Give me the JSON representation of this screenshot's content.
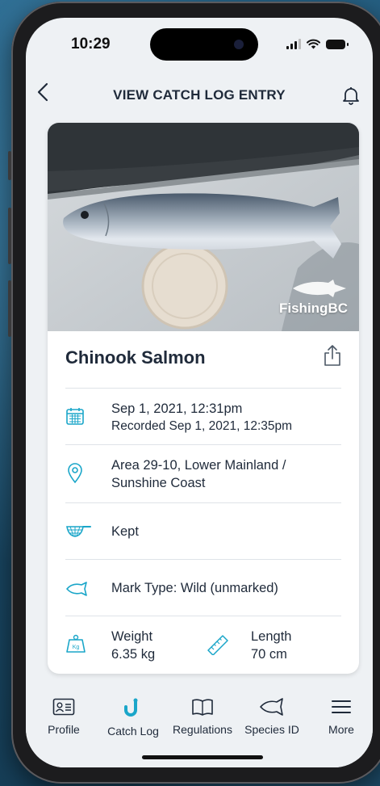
{
  "status": {
    "time": "10:29"
  },
  "header": {
    "title": "VIEW CATCH LOG ENTRY"
  },
  "photo": {
    "brand_text": "FishingBC"
  },
  "entry": {
    "species": "Chinook Salmon",
    "date": "Sep 1, 2021, 12:31pm",
    "recorded": "Recorded Sep 1, 2021, 12:35pm",
    "location_line1": "Area 29-10, Lower Mainland /",
    "location_line2": "Sunshine Coast",
    "disposition": "Kept",
    "mark_type": "Mark Type: Wild (unmarked)",
    "weight_label": "Weight",
    "weight_value": "6.35 kg",
    "length_label": "Length",
    "length_value": "70 cm",
    "weight_icon_text": "Kg"
  },
  "tabs": [
    {
      "label": "Profile",
      "icon": "profile-card-icon"
    },
    {
      "label": "Catch Log",
      "icon": "fish-hook-icon",
      "active": true
    },
    {
      "label": "Regulations",
      "icon": "book-icon"
    },
    {
      "label": "Species ID",
      "icon": "fish-outline-icon"
    },
    {
      "label": "More",
      "icon": "menu-icon"
    }
  ],
  "colors": {
    "accent": "#1aa6c9",
    "text": "#1f2a3a",
    "divider": "#dfe3e8"
  }
}
